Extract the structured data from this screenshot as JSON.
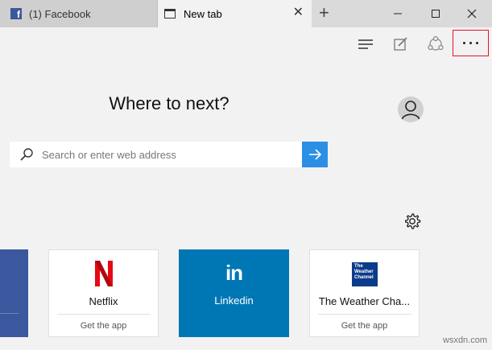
{
  "tabs": [
    {
      "label": "(1) Facebook",
      "active": false
    },
    {
      "label": "New tab",
      "active": true
    }
  ],
  "icons": {
    "close_tab": "close-icon",
    "new_tab": "plus-icon",
    "minimize": "minimize-icon",
    "maximize": "maximize-icon",
    "close_window": "close-icon",
    "hub": "hub-icon",
    "note": "web-note-icon",
    "share": "share-icon",
    "more": "more-icon",
    "search": "search-icon",
    "go": "arrow-right-icon",
    "settings": "gear-icon",
    "avatar": "avatar-icon"
  },
  "main": {
    "heading": "Where to next?",
    "search_placeholder": "Search or enter web address"
  },
  "tiles": [
    {
      "name": "Netflix",
      "action": "Get the app"
    },
    {
      "name": "Linkedin",
      "logo_text": "in"
    },
    {
      "name": "The Weather Cha...",
      "action": "Get the app",
      "logo_text": "The Weather Channel"
    }
  ],
  "watermark": "wsxdn.com",
  "colors": {
    "accent": "#2b8fe6",
    "highlight": "#e81123",
    "linkedin": "#0077b5",
    "netflix": "#e50914",
    "facebook": "#3b5998"
  }
}
